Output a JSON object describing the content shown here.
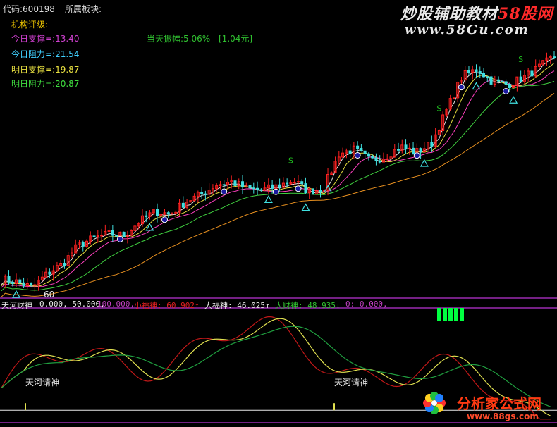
{
  "header": {
    "code_label": "代码:600198",
    "sector_label": "所属板块:"
  },
  "info": {
    "rating_label": "机构评级:",
    "today_support": "今日支撑=:13.40",
    "today_resistance": "今日阻力=:21.54",
    "tomorrow_support": "明日支撑=:19.87",
    "tomorrow_resistance": "明日阻力=:20.87",
    "amplitude_label": "当天振幅:5.06%",
    "amplitude_value": "[1.04元]"
  },
  "markers": {
    "low_value": "60",
    "sell_symbol": "S"
  },
  "indicator": {
    "name": "天河财神",
    "params": "0.000, 50.000,",
    "p3": "100.000,",
    "xiao_fu_shen": "小福神: 60.902↑",
    "da_fu_shen": "大福神: 46.025↑",
    "da_cai_shen": "大财神: 48.935↓",
    "zero": "0: 0.000,",
    "signal_label": "天河请神"
  },
  "watermarks": {
    "top_prefix": "炒股辅助教材",
    "top_brand": "58股网",
    "top_url": "www.58Gu.com",
    "bottom_brand": "分析家公式网",
    "bottom_url": "www.88gs.com"
  },
  "colors": {
    "up": "#ff2020",
    "down": "#40e0e0",
    "ma_white": "#e8e8e8",
    "ma_yellow": "#e8e040",
    "ma_pink": "#ff40c0",
    "ma_green": "#40d040",
    "ma_orange": "#e89020",
    "osc_red": "#c01818",
    "osc_yellow": "#e0e050",
    "osc_green": "#20a040",
    "bar_green": "#00ff40",
    "frame_purple": "#9a2ab0"
  },
  "chart_data": [
    {
      "type": "candlestick",
      "title": "",
      "y_scale": "price",
      "annotations": [
        {
          "text": "60",
          "label": "period low marker"
        },
        {
          "text": "S",
          "label": "sell signal"
        }
      ],
      "price_reference": {
        "today_support": 13.4,
        "today_resistance": 21.54,
        "tomorrow_support": 19.87,
        "tomorrow_resistance": 20.87
      },
      "close_trend": [
        10.2,
        10.0,
        9.6,
        10.6,
        11.3,
        12.6,
        13.1,
        13.4,
        13.3,
        14.3,
        15.0,
        14.8,
        15.7,
        16.2,
        16.9,
        17.1,
        16.6,
        16.5,
        16.8,
        17.2,
        16.4,
        16.7,
        19.1,
        19.4,
        18.6,
        18.9,
        19.6,
        19.2,
        19.8,
        22.2,
        24.6,
        25.1,
        24.2,
        24.0,
        24.5,
        25.2,
        26.0
      ]
    },
    {
      "type": "line",
      "title": "天河财神",
      "series": [
        {
          "name": "小福神",
          "last": 60.902
        },
        {
          "name": "大福神",
          "last": 46.025
        },
        {
          "name": "大财神",
          "last": 48.935
        }
      ],
      "reference_lines": [
        0,
        50,
        100
      ],
      "ylim": [
        0,
        100
      ]
    }
  ]
}
